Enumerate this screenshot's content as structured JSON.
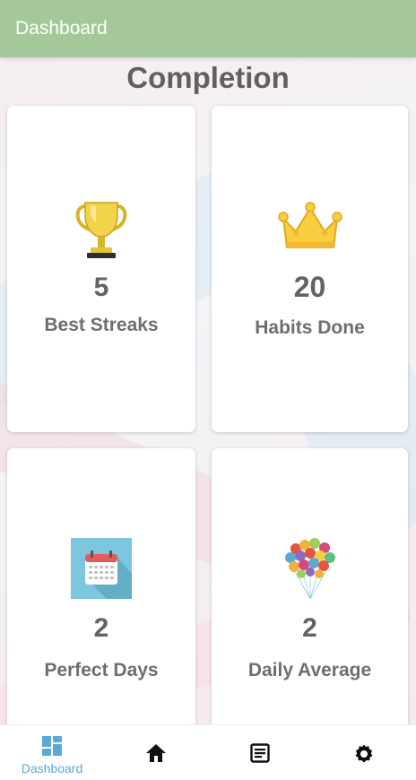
{
  "app_bar": {
    "title": "Dashboard"
  },
  "page": {
    "title": "Completion"
  },
  "stats": [
    {
      "icon": "trophy-icon",
      "value": "5",
      "label": "Best Streaks"
    },
    {
      "icon": "crown-icon",
      "value": "20",
      "label": "Habits Done"
    },
    {
      "icon": "calendar-icon",
      "value": "2",
      "label": "Perfect Days"
    },
    {
      "icon": "balloons-icon",
      "value": "2",
      "label": "Daily Average"
    }
  ],
  "bottom_nav": {
    "items": [
      {
        "icon": "dashboard-icon",
        "label": "Dashboard",
        "active": true
      },
      {
        "icon": "home-icon",
        "label": "",
        "active": false
      },
      {
        "icon": "notes-icon",
        "label": "",
        "active": false
      },
      {
        "icon": "gear-icon",
        "label": "",
        "active": false
      }
    ]
  },
  "colors": {
    "app_bar": "#a3c99b",
    "active_nav": "#5aa9d6",
    "text_dark": "#636363"
  }
}
